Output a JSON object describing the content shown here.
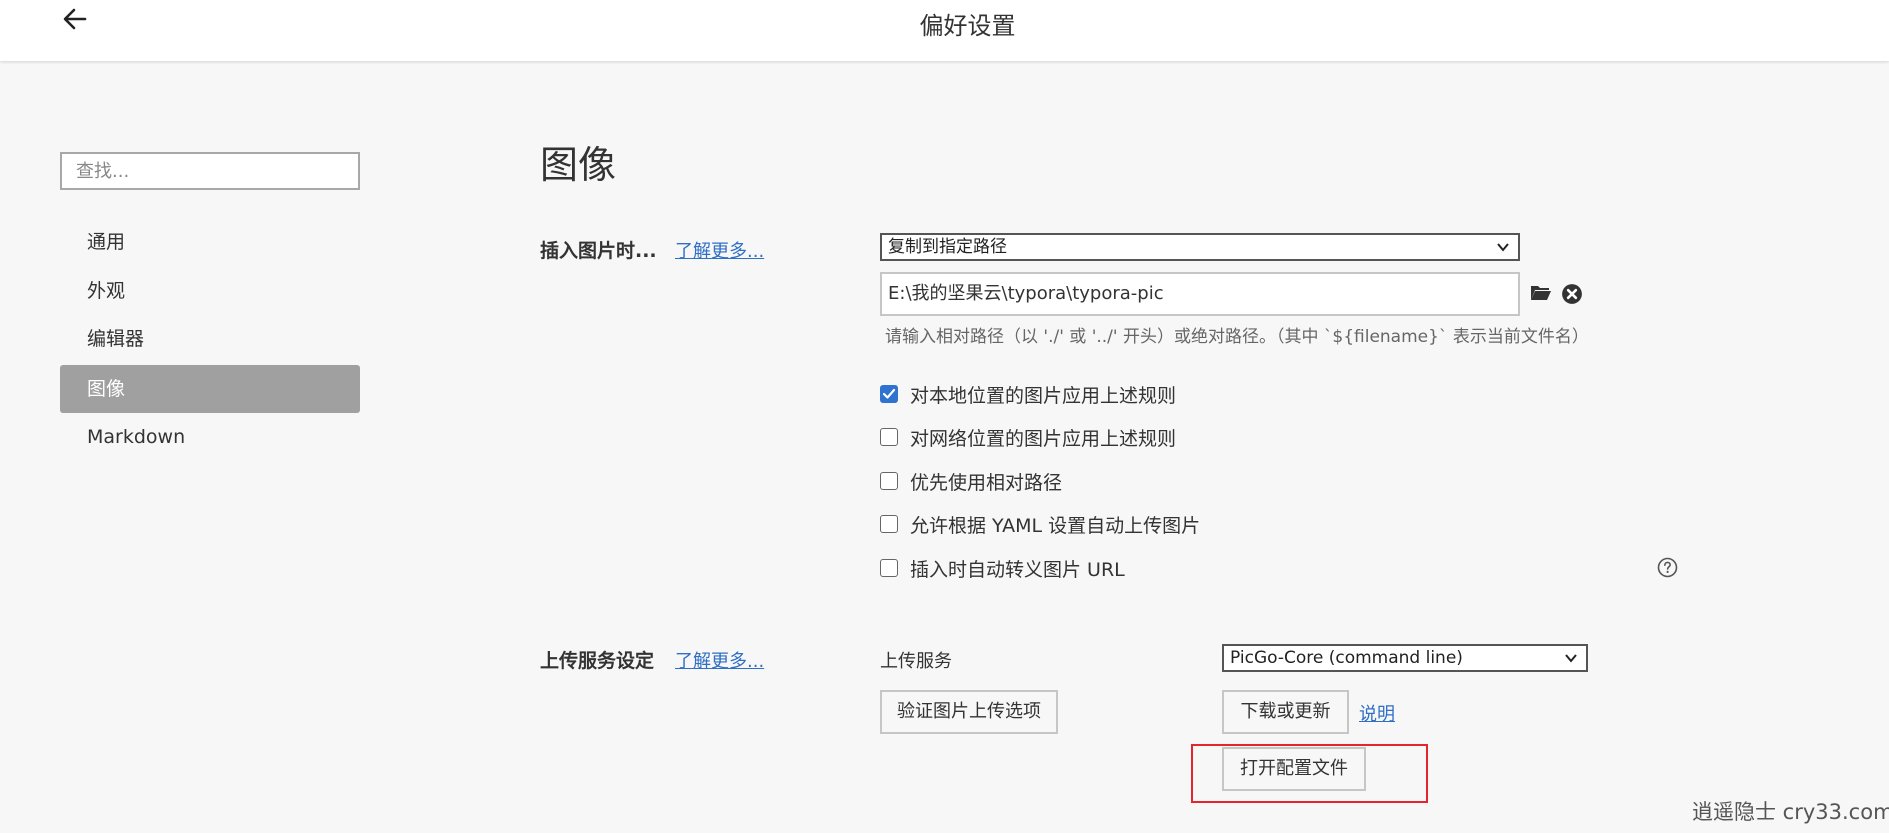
{
  "header": {
    "title": "偏好设置",
    "back_icon": "arrow-left-icon"
  },
  "sidebar": {
    "search_placeholder": "查找...",
    "items": [
      {
        "label": "通用",
        "active": false
      },
      {
        "label": "外观",
        "active": false
      },
      {
        "label": "编辑器",
        "active": false
      },
      {
        "label": "图像",
        "active": true
      },
      {
        "label": "Markdown",
        "active": false
      }
    ]
  },
  "main": {
    "title": "图像",
    "insert_image": {
      "label": "插入图片时...",
      "learn_more": "了解更多...",
      "action_selected": "复制到指定路径",
      "path_value": "E:\\我的坚果云\\typora\\typora-pic",
      "hint": "请输入相对路径（以 './' 或 '../' 开头）或绝对路径。（其中 `${filename}` 表示当前文件名）",
      "folder_icon": "folder-icon",
      "clear_icon": "close-circle-icon",
      "options": [
        {
          "label": "对本地位置的图片应用上述规则",
          "checked": true
        },
        {
          "label": "对网络位置的图片应用上述规则",
          "checked": false
        },
        {
          "label": "优先使用相对路径",
          "checked": false
        },
        {
          "label": "允许根据 YAML 设置自动上传图片",
          "checked": false
        },
        {
          "label": "插入时自动转义图片 URL",
          "checked": false
        }
      ],
      "help_icon": "question-circle-icon"
    },
    "upload_service": {
      "label": "上传服务设定",
      "learn_more": "了解更多...",
      "service_label": "上传服务",
      "service_selected": "PicGo-Core (command line)",
      "verify_button": "验证图片上传选项",
      "download_button": "下载或更新",
      "docs_link": "说明",
      "open_config_button": "打开配置文件"
    }
  },
  "watermark": "逍遥隐士 cry33.com",
  "colors": {
    "accent": "#2f72d0",
    "link": "#2f6fc5",
    "nav_active_bg": "#a0a0a0",
    "highlight": "#e5242b"
  }
}
